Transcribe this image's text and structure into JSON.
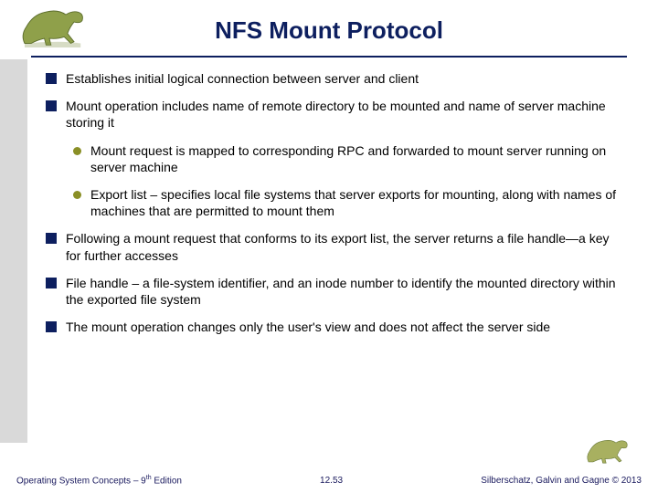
{
  "title": "NFS Mount Protocol",
  "bullets": [
    {
      "level": 1,
      "text": "Establishes initial logical connection between server and client"
    },
    {
      "level": 1,
      "text": "Mount operation includes name of remote directory to be mounted and name of server machine storing it"
    },
    {
      "level": 2,
      "text": "Mount request is mapped to corresponding RPC and forwarded to mount server running on server machine"
    },
    {
      "level": 2,
      "text": "Export list – specifies local file systems that server exports for mounting, along with names of machines that are permitted to mount them"
    },
    {
      "level": 1,
      "text": "Following a mount request that conforms to its export list, the server returns a file handle—a key for further accesses"
    },
    {
      "level": 1,
      "text": "File handle – a file-system identifier, and an inode number to identify the mounted directory within the exported file system"
    },
    {
      "level": 1,
      "text": "The mount operation changes only the user's view and does not affect the server side"
    }
  ],
  "footer": {
    "left_a": "Operating System Concepts – 9",
    "left_sup": "th",
    "left_b": " Edition",
    "center": "12.53",
    "right": "Silberschatz, Galvin and Gagne © 2013"
  }
}
